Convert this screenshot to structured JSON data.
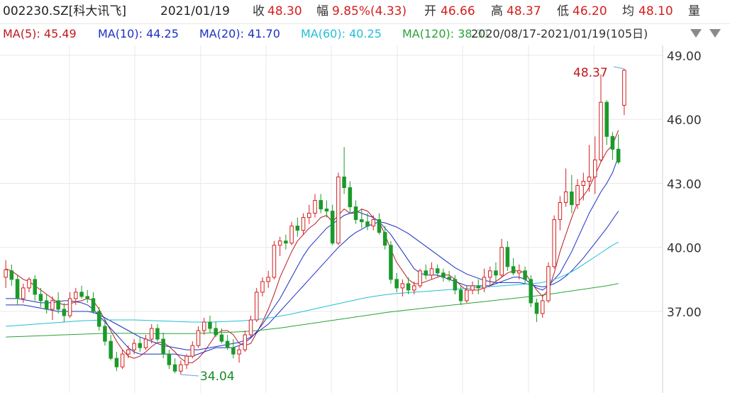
{
  "header": {
    "symbol": "002230.SZ[科大讯飞]",
    "date": "2021/01/19",
    "close_label": "收",
    "close_value": "48.30",
    "change_label": "幅",
    "change_value": "9.85%(4.33)",
    "open_label": "开",
    "open_value": "46.66",
    "high_label": "高",
    "high_value": "48.37",
    "low_label": "低",
    "low_value": "46.20",
    "avg_label": "均",
    "avg_value": "48.10",
    "volume_label": "量"
  },
  "legend": {
    "ma5": "MA(5): 45.49",
    "ma10": "MA(10): 44.25",
    "ma20": "MA(20): 41.70",
    "ma60": "MA(60): 40.25",
    "ma120": "MA(120): 38.31",
    "range": "2020/08/17-2021/01/19(105日)"
  },
  "colors": {
    "up": "#d4201e",
    "down": "#1a9a2a",
    "ma5": "#c0181e",
    "ma10": "#1c2fc4",
    "ma20": "#1c2fc4",
    "ma60": "#22bfd6",
    "ma120": "#2aa23a",
    "grid": "#e8e8e8"
  },
  "icons": [
    "collapse-triangle-icon",
    "settings-triangle-icon"
  ],
  "chart_data": {
    "type": "candlestick",
    "y_ticks": [
      "49.00",
      "46.00",
      "43.00",
      "40.00",
      "37.00"
    ],
    "ylim": [
      33.5,
      49.5
    ],
    "grid": true,
    "annotations": {
      "max_label": "48.37",
      "min_label": "34.04"
    },
    "candles": [
      [
        38.6,
        39.4,
        38.1,
        38.95
      ],
      [
        38.9,
        39.2,
        38.2,
        38.5
      ],
      [
        38.5,
        38.7,
        37.3,
        37.6
      ],
      [
        37.6,
        38.3,
        37.4,
        38.1
      ],
      [
        38.1,
        38.6,
        37.9,
        38.5
      ],
      [
        38.5,
        38.7,
        37.5,
        37.8
      ],
      [
        37.8,
        38.1,
        37.2,
        37.5
      ],
      [
        37.5,
        37.8,
        36.9,
        37.1
      ],
      [
        37.1,
        37.7,
        36.6,
        37.5
      ],
      [
        37.5,
        37.9,
        36.9,
        37.1
      ],
      [
        37.1,
        37.4,
        36.5,
        36.8
      ],
      [
        36.8,
        37.9,
        36.7,
        37.6
      ],
      [
        37.6,
        38.1,
        37.3,
        37.9
      ],
      [
        37.9,
        38.2,
        37.6,
        37.7
      ],
      [
        37.7,
        38.0,
        37.4,
        37.6
      ],
      [
        37.6,
        37.9,
        36.9,
        37.0
      ],
      [
        37.0,
        37.2,
        36.1,
        36.3
      ],
      [
        36.3,
        36.6,
        35.4,
        35.6
      ],
      [
        35.6,
        35.9,
        34.7,
        34.8
      ],
      [
        34.8,
        35.1,
        34.2,
        34.4
      ],
      [
        34.4,
        35.2,
        34.3,
        35.0
      ],
      [
        35.0,
        35.4,
        34.8,
        35.2
      ],
      [
        35.2,
        35.7,
        35.0,
        35.5
      ],
      [
        35.5,
        35.8,
        35.1,
        35.3
      ],
      [
        35.3,
        35.9,
        35.2,
        35.7
      ],
      [
        35.7,
        36.4,
        35.5,
        36.2
      ],
      [
        36.2,
        36.4,
        35.6,
        35.7
      ],
      [
        35.7,
        36.0,
        34.8,
        35.0
      ],
      [
        35.0,
        35.2,
        34.3,
        34.5
      ],
      [
        34.5,
        34.8,
        34.1,
        34.2
      ],
      [
        34.2,
        34.7,
        34.04,
        34.5
      ],
      [
        34.5,
        35.0,
        34.3,
        34.9
      ],
      [
        34.9,
        35.6,
        34.8,
        35.4
      ],
      [
        35.4,
        36.3,
        35.3,
        36.1
      ],
      [
        36.1,
        36.7,
        35.9,
        36.5
      ],
      [
        36.5,
        36.8,
        36.0,
        36.2
      ],
      [
        36.2,
        36.5,
        35.8,
        35.9
      ],
      [
        35.9,
        36.2,
        35.5,
        35.6
      ],
      [
        35.6,
        35.9,
        35.2,
        35.3
      ],
      [
        35.3,
        35.7,
        34.8,
        35.0
      ],
      [
        35.0,
        35.4,
        34.6,
        35.2
      ],
      [
        35.2,
        36.1,
        35.1,
        35.9
      ],
      [
        35.9,
        36.8,
        35.8,
        36.6
      ],
      [
        36.6,
        38.1,
        36.5,
        37.9
      ],
      [
        37.9,
        38.6,
        37.7,
        38.4
      ],
      [
        38.4,
        38.9,
        38.1,
        38.6
      ],
      [
        38.6,
        40.3,
        38.5,
        40.1
      ],
      [
        40.1,
        40.5,
        39.6,
        40.3
      ],
      [
        40.3,
        40.6,
        39.9,
        40.2
      ],
      [
        40.2,
        41.2,
        40.1,
        41.0
      ],
      [
        41.0,
        41.4,
        40.5,
        40.8
      ],
      [
        40.8,
        41.6,
        40.6,
        41.4
      ],
      [
        41.4,
        42.0,
        41.1,
        41.6
      ],
      [
        41.6,
        42.5,
        41.4,
        42.2
      ],
      [
        42.2,
        42.5,
        41.6,
        41.8
      ],
      [
        41.8,
        42.2,
        41.4,
        41.7
      ],
      [
        41.7,
        42.0,
        40.1,
        40.2
      ],
      [
        40.2,
        43.5,
        40.1,
        43.3
      ],
      [
        43.3,
        44.7,
        42.5,
        42.8
      ],
      [
        42.8,
        43.1,
        41.6,
        41.9
      ],
      [
        41.9,
        42.2,
        41.1,
        41.3
      ],
      [
        41.3,
        41.8,
        40.9,
        41.2
      ],
      [
        41.2,
        41.6,
        40.8,
        41.0
      ],
      [
        41.0,
        41.5,
        40.8,
        41.3
      ],
      [
        41.3,
        41.6,
        40.6,
        40.7
      ],
      [
        40.7,
        41.0,
        39.9,
        40.1
      ],
      [
        40.1,
        40.3,
        38.3,
        38.5
      ],
      [
        38.5,
        38.8,
        37.9,
        38.1
      ],
      [
        38.1,
        38.5,
        37.7,
        38.3
      ],
      [
        38.3,
        38.6,
        37.8,
        38.0
      ],
      [
        38.0,
        38.4,
        37.8,
        38.2
      ],
      [
        38.2,
        39.0,
        38.1,
        38.9
      ],
      [
        38.9,
        39.2,
        38.5,
        38.7
      ],
      [
        38.7,
        39.3,
        38.5,
        39.0
      ],
      [
        39.0,
        39.2,
        38.6,
        38.8
      ],
      [
        38.8,
        39.0,
        38.4,
        38.6
      ],
      [
        38.6,
        38.9,
        38.4,
        38.5
      ],
      [
        38.5,
        38.7,
        37.8,
        38.0
      ],
      [
        38.0,
        38.2,
        37.3,
        37.5
      ],
      [
        37.5,
        38.2,
        37.4,
        38.0
      ],
      [
        38.0,
        38.4,
        37.8,
        38.2
      ],
      [
        38.2,
        38.5,
        37.8,
        38.1
      ],
      [
        38.1,
        39.0,
        37.9,
        38.6
      ],
      [
        38.6,
        39.1,
        38.2,
        38.9
      ],
      [
        38.9,
        39.3,
        38.4,
        38.7
      ],
      [
        38.7,
        40.4,
        38.6,
        40.0
      ],
      [
        40.0,
        40.3,
        38.9,
        39.1
      ],
      [
        39.1,
        39.5,
        38.7,
        38.8
      ],
      [
        38.8,
        39.2,
        38.5,
        38.9
      ],
      [
        38.9,
        39.1,
        38.3,
        38.5
      ],
      [
        38.5,
        38.7,
        37.2,
        37.4
      ],
      [
        37.4,
        37.6,
        36.5,
        36.9
      ],
      [
        36.9,
        37.8,
        36.7,
        37.5
      ],
      [
        37.5,
        39.3,
        37.4,
        39.1
      ],
      [
        39.1,
        41.5,
        39.0,
        41.3
      ],
      [
        41.3,
        42.4,
        40.8,
        42.1
      ],
      [
        42.1,
        43.7,
        41.9,
        42.6
      ],
      [
        42.6,
        43.4,
        41.6,
        42.0
      ],
      [
        42.0,
        43.2,
        41.8,
        42.9
      ],
      [
        42.9,
        43.5,
        42.2,
        43.1
      ],
      [
        43.1,
        44.8,
        42.6,
        43.3
      ],
      [
        43.3,
        45.2,
        42.5,
        44.1
      ],
      [
        44.1,
        48.1,
        44.0,
        46.8
      ],
      [
        46.8,
        46.9,
        44.8,
        45.2
      ],
      [
        45.2,
        45.4,
        44.1,
        44.6
      ],
      [
        44.6,
        45.3,
        43.9,
        44.0
      ],
      [
        46.66,
        48.37,
        46.2,
        48.3
      ]
    ],
    "ma_series": [
      {
        "name": "MA(5)",
        "key": "ma5",
        "values": [
          39.0,
          38.9,
          38.7,
          38.5,
          38.4,
          38.2,
          38.0,
          37.8,
          37.6,
          37.4,
          37.3,
          37.35,
          37.45,
          37.5,
          37.6,
          37.5,
          37.1,
          36.6,
          36.1,
          35.6,
          35.2,
          34.9,
          34.8,
          34.9,
          35.1,
          35.35,
          35.55,
          35.55,
          35.35,
          35.1,
          34.8,
          34.6,
          34.6,
          34.8,
          35.1,
          35.5,
          35.9,
          36.1,
          36.1,
          35.9,
          35.5,
          35.4,
          35.5,
          36.0,
          36.5,
          37.1,
          37.8,
          38.6,
          39.2,
          39.8,
          40.3,
          40.6,
          40.9,
          41.1,
          41.4,
          41.5,
          41.2,
          41.5,
          41.8,
          41.6,
          41.6,
          41.8,
          41.7,
          41.4,
          41.2,
          40.6,
          39.9,
          39.3,
          38.9,
          38.5,
          38.3,
          38.3,
          38.4,
          38.5,
          38.6,
          38.7,
          38.7,
          38.5,
          38.2,
          38.0,
          38.0,
          38.0,
          38.1,
          38.2,
          38.4,
          38.6,
          38.8,
          38.9,
          38.9,
          38.8,
          38.4,
          38.0,
          37.7,
          38.0,
          38.8,
          39.8,
          40.6,
          41.4,
          42.1,
          42.4,
          42.8,
          43.4,
          44.0,
          44.5,
          44.8,
          45.49
        ]
      },
      {
        "name": "MA(10)",
        "key": "ma10",
        "values": [
          37.6,
          37.6,
          37.6,
          37.55,
          37.5,
          37.45,
          37.4,
          37.4,
          37.4,
          37.45,
          37.5,
          37.5,
          37.45,
          37.4,
          37.3,
          37.1,
          36.8,
          36.5,
          36.2,
          35.9,
          35.6,
          35.3,
          35.1,
          35.0,
          35.0,
          35.0,
          35.0,
          35.0,
          35.0,
          35.0,
          34.95,
          34.9,
          34.9,
          35.0,
          35.1,
          35.2,
          35.3,
          35.3,
          35.3,
          35.3,
          35.4,
          35.55,
          35.75,
          36.05,
          36.4,
          36.8,
          37.2,
          37.6,
          38.1,
          38.6,
          39.1,
          39.6,
          40.0,
          40.3,
          40.6,
          40.9,
          41.1,
          41.3,
          41.5,
          41.6,
          41.7,
          41.6,
          41.5,
          41.4,
          41.2,
          40.9,
          40.6,
          40.2,
          39.8,
          39.4,
          39.0,
          38.8,
          38.7,
          38.7,
          38.7,
          38.6,
          38.5,
          38.4,
          38.3,
          38.2,
          38.2,
          38.2,
          38.2,
          38.2,
          38.3,
          38.4,
          38.5,
          38.6,
          38.6,
          38.5,
          38.3,
          38.1,
          38.0,
          38.2,
          38.5,
          38.8,
          39.3,
          39.8,
          40.4,
          41.0,
          41.6,
          42.1,
          42.6,
          43.0,
          43.5,
          44.25
        ]
      },
      {
        "name": "MA(20)",
        "key": "ma20",
        "values": [
          37.3,
          37.3,
          37.3,
          37.3,
          37.25,
          37.2,
          37.15,
          37.1,
          37.05,
          37.0,
          37.0,
          37.0,
          37.0,
          37.0,
          37.0,
          36.95,
          36.85,
          36.7,
          36.55,
          36.4,
          36.25,
          36.1,
          35.95,
          35.8,
          35.7,
          35.6,
          35.5,
          35.4,
          35.35,
          35.3,
          35.25,
          35.2,
          35.2,
          35.2,
          35.25,
          35.3,
          35.35,
          35.4,
          35.45,
          35.5,
          35.55,
          35.65,
          35.8,
          36.0,
          36.2,
          36.4,
          36.7,
          37.0,
          37.3,
          37.6,
          37.9,
          38.2,
          38.5,
          38.8,
          39.1,
          39.4,
          39.7,
          40.0,
          40.25,
          40.5,
          40.7,
          40.85,
          41.0,
          41.1,
          41.2,
          41.15,
          41.05,
          40.95,
          40.8,
          40.65,
          40.45,
          40.25,
          40.05,
          39.85,
          39.65,
          39.45,
          39.25,
          39.05,
          38.9,
          38.75,
          38.65,
          38.55,
          38.45,
          38.4,
          38.35,
          38.35,
          38.35,
          38.35,
          38.35,
          38.3,
          38.25,
          38.2,
          38.15,
          38.2,
          38.3,
          38.45,
          38.65,
          38.9,
          39.2,
          39.5,
          39.85,
          40.2,
          40.55,
          40.9,
          41.3,
          41.7
        ]
      },
      {
        "name": "MA(60)",
        "key": "ma60",
        "values": [
          36.3,
          36.32,
          36.34,
          36.36,
          36.38,
          36.4,
          36.42,
          36.44,
          36.46,
          36.48,
          36.5,
          36.52,
          36.54,
          36.56,
          36.57,
          36.58,
          36.59,
          36.6,
          36.6,
          36.6,
          36.6,
          36.6,
          36.6,
          36.59,
          36.58,
          36.57,
          36.56,
          36.55,
          36.54,
          36.53,
          36.52,
          36.51,
          36.5,
          36.5,
          36.5,
          36.5,
          36.51,
          36.52,
          36.53,
          36.54,
          36.55,
          36.57,
          36.59,
          36.62,
          36.65,
          36.69,
          36.73,
          36.78,
          36.83,
          36.88,
          36.94,
          37.0,
          37.06,
          37.12,
          37.18,
          37.24,
          37.3,
          37.36,
          37.42,
          37.48,
          37.54,
          37.6,
          37.65,
          37.7,
          37.74,
          37.78,
          37.81,
          37.84,
          37.86,
          37.88,
          37.9,
          37.92,
          37.94,
          37.96,
          37.98,
          38.0,
          38.02,
          38.04,
          38.06,
          38.08,
          38.1,
          38.12,
          38.14,
          38.16,
          38.18,
          38.2,
          38.22,
          38.24,
          38.26,
          38.28,
          38.3,
          38.32,
          38.36,
          38.42,
          38.5,
          38.6,
          38.72,
          38.86,
          39.02,
          39.2,
          39.38,
          39.56,
          39.74,
          39.92,
          40.1,
          40.25
        ]
      },
      {
        "name": "MA(120)",
        "key": "ma120",
        "values": [
          35.8,
          35.81,
          35.82,
          35.83,
          35.84,
          35.85,
          35.86,
          35.87,
          35.88,
          35.89,
          35.9,
          35.91,
          35.92,
          35.93,
          35.94,
          35.95,
          35.96,
          35.97,
          35.97,
          35.97,
          35.97,
          35.97,
          35.97,
          35.96,
          35.96,
          35.96,
          35.96,
          35.96,
          35.96,
          35.96,
          35.96,
          35.96,
          35.96,
          35.97,
          35.98,
          35.99,
          36.0,
          36.01,
          36.02,
          36.03,
          36.04,
          36.06,
          36.08,
          36.1,
          36.13,
          36.16,
          36.19,
          36.22,
          36.26,
          36.3,
          36.34,
          36.38,
          36.42,
          36.46,
          36.5,
          36.54,
          36.58,
          36.62,
          36.66,
          36.7,
          36.74,
          36.78,
          36.82,
          36.86,
          36.9,
          36.94,
          36.98,
          37.01,
          37.04,
          37.07,
          37.1,
          37.13,
          37.16,
          37.19,
          37.22,
          37.25,
          37.28,
          37.31,
          37.34,
          37.37,
          37.4,
          37.43,
          37.46,
          37.49,
          37.52,
          37.55,
          37.58,
          37.61,
          37.64,
          37.67,
          37.7,
          37.73,
          37.76,
          37.8,
          37.84,
          37.88,
          37.92,
          37.96,
          38.0,
          38.04,
          38.08,
          38.12,
          38.16,
          38.2,
          38.25,
          38.31
        ]
      }
    ]
  }
}
